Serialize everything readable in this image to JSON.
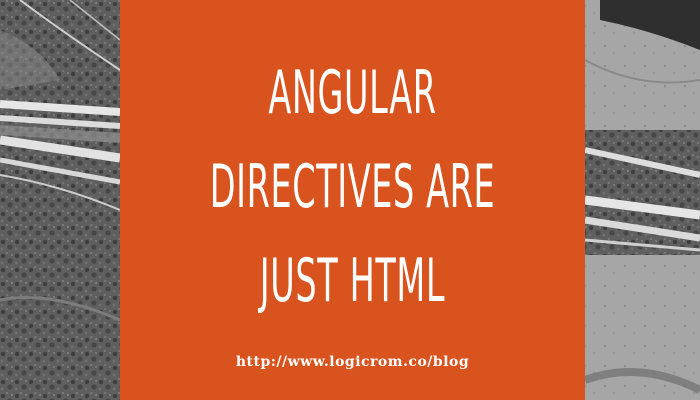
{
  "headline": {
    "line1": "Angular",
    "line2": "directives are",
    "line3": "just HTML"
  },
  "url": "http://www.logicrom.co/blog",
  "background": {
    "photo": "aerial-highway-grayscale",
    "panel_color": "#d9531e",
    "text_color": "#ffffff"
  }
}
